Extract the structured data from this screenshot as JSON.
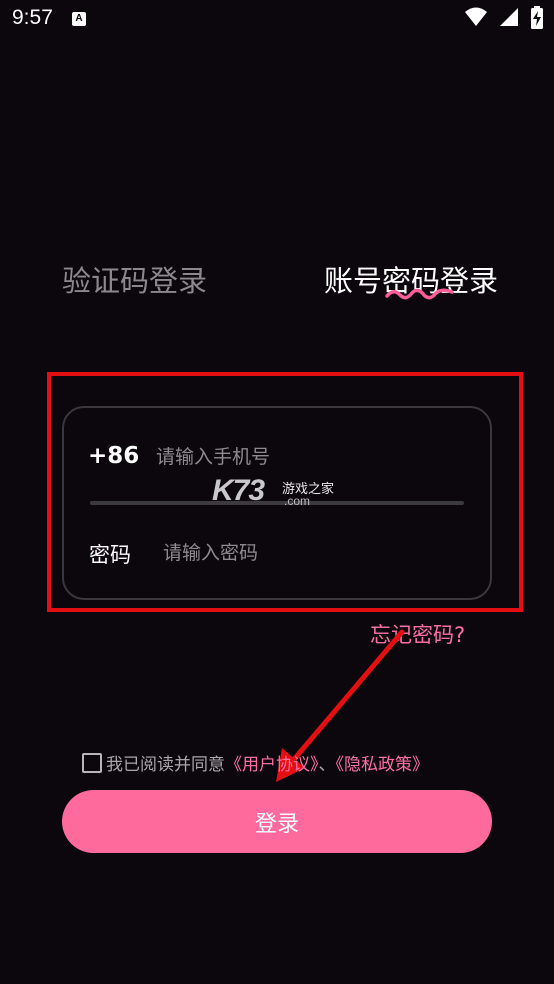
{
  "status_bar": {
    "time": "9:57",
    "notification_letter": "A",
    "icons": [
      "wifi-icon",
      "signal-icon",
      "battery-charging-icon"
    ]
  },
  "tabs": {
    "sms_login": "验证码登录",
    "password_login": "账号密码登录",
    "active": "password_login"
  },
  "form": {
    "country_code": "+86",
    "phone_placeholder": "请输入手机号",
    "password_label": "密码",
    "password_placeholder": "请输入密码"
  },
  "watermark": {
    "logo": "K73",
    "text": "游戏之家",
    "domain": ".com"
  },
  "forgot_password": "忘记密码?",
  "agreement": {
    "prefix": "我已阅读并同意",
    "user_agreement": "《用户协议》",
    "separator": "、",
    "privacy_policy": "《隐私政策》",
    "checked": false
  },
  "login_button": "登录",
  "colors": {
    "background": "#0b070c",
    "accent_pink": "#ff6a9d",
    "annotation_red": "#e30f12"
  }
}
